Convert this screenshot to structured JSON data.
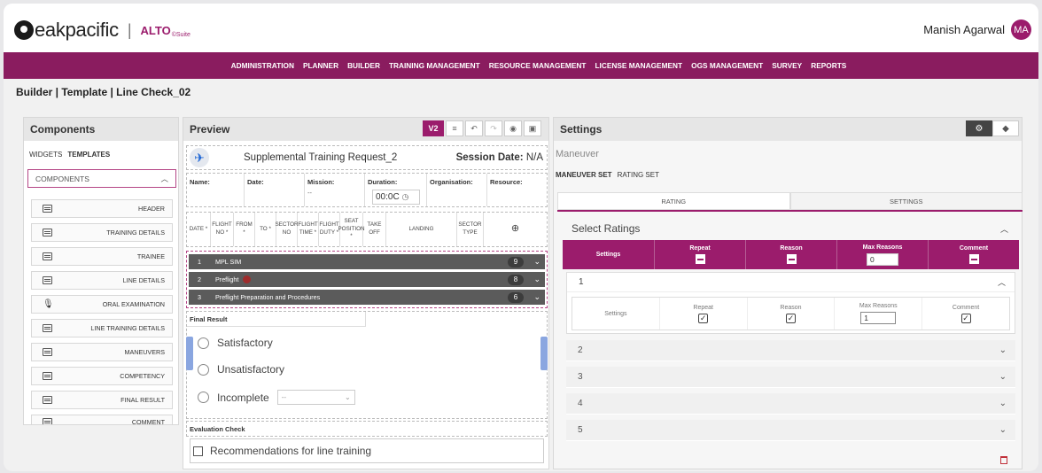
{
  "header": {
    "brand_text": "eakpacific",
    "separator": "|",
    "product": "ALTO",
    "product_suffix": "©Suite",
    "user_name": "Manish Agarwal",
    "user_initials": "MA"
  },
  "nav": [
    "ADMINISTRATION",
    "PLANNER",
    "BUILDER",
    "TRAINING MANAGEMENT",
    "RESOURCE MANAGEMENT",
    "LICENSE MANAGEMENT",
    "OGS MANAGEMENT",
    "SURVEY",
    "REPORTS"
  ],
  "breadcrumb": "Builder | Template | Line Check_02",
  "components": {
    "title": "Components",
    "tab_widgets": "WIDGETS",
    "tab_templates": "TEMPLATES",
    "dropdown": "COMPONENTS",
    "items": [
      "HEADER",
      "TRAINING DETAILS",
      "TRAINEE",
      "LINE DETAILS",
      "ORAL EXAMINATION",
      "LINE TRAINING DETAILS",
      "MANEUVERS",
      "COMPETENCY",
      "FINAL RESULT",
      "COMMENT"
    ]
  },
  "preview": {
    "title": "Preview",
    "version_label": "V2",
    "request_title": "Supplemental Training Request_2",
    "session_label": "Session Date:",
    "session_value": "N/A",
    "fields": {
      "name": "Name:",
      "date": "Date:",
      "mission": "Mission:",
      "mission_value": "--",
      "duration": "Duration:",
      "duration_value": "00:0C",
      "organisation": "Organisation:",
      "resource": "Resource:"
    },
    "table_headers": [
      "DATE *",
      "FLIGHT NO *",
      "FROM *",
      "TO *",
      "SECTOR NO",
      "FLIGHT TIME *",
      "FLIGHT DUTY *",
      "SEAT POSITION *",
      "TAKE OFF",
      "LANDING",
      "SECTOR TYPE"
    ],
    "maneuvers": [
      {
        "num": "1",
        "label": "MPL SIM",
        "count": "9"
      },
      {
        "num": "2",
        "label": "Preflight",
        "count": "8"
      },
      {
        "num": "3",
        "label": "Preflight Preparation and Procedures",
        "count": "6"
      }
    ],
    "final_result_label": "Final Result",
    "options": [
      "Satisfactory",
      "Unsatisfactory",
      "Incomplete"
    ],
    "incomplete_select": "--",
    "evaluation_label": "Evaluation Check",
    "recommendation": "Recommendations for line training"
  },
  "settings": {
    "title": "Settings",
    "section": "Maneuver",
    "tab_maneuver_set": "MANEUVER SET",
    "tab_rating_set": "RATING SET",
    "btn_rating": "RATING",
    "btn_settings": "SETTINGS",
    "select_ratings": "Select Ratings",
    "grid_headers": [
      "Settings",
      "Repeat",
      "Reason",
      "Max Reasons",
      "Comment"
    ],
    "header_max_value": "0",
    "row1": {
      "num": "1",
      "labels": [
        "Settings",
        "Repeat",
        "Reason",
        "Max Reasons",
        "Comment"
      ],
      "max_value": "1"
    },
    "other_rows": [
      "2",
      "3",
      "4",
      "5"
    ]
  }
}
